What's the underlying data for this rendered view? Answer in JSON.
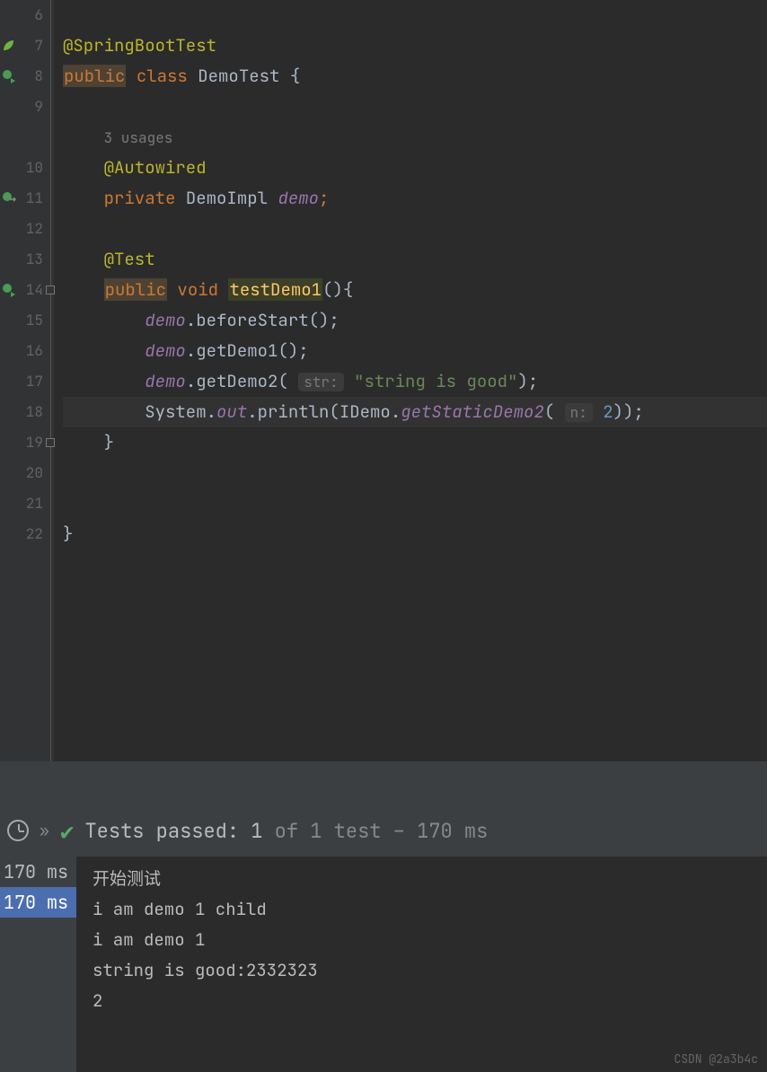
{
  "gutter": {
    "lines": [
      "6",
      "7",
      "8",
      "9",
      "",
      "10",
      "11",
      "12",
      "13",
      "14",
      "15",
      "16",
      "17",
      "18",
      "19",
      "20",
      "21",
      "22"
    ]
  },
  "code": {
    "annotation1": "@SpringBootTest",
    "kwPublic": "public",
    "kwClass": "class",
    "clsName": "DemoTest",
    "braceOpen": "{",
    "usages": "3 usages",
    "autowired": "@Autowired",
    "kwPrivate": "private",
    "type": "DemoImpl",
    "field": "demo",
    "testAnn": "@Test",
    "kwVoid": "void",
    "methodName": "testDemo1",
    "methodSig": "(){",
    "line15a": "demo",
    "line15b": ".beforeStart();",
    "line16a": "demo",
    "line16b": ".getDemo1();",
    "line17a": "demo",
    "line17b": ".getDemo2(",
    "hint17": "str:",
    "str17": "\"string is good\"",
    "line17c": ");",
    "line18a": "System.",
    "line18out": "out",
    "line18b": ".println(IDemo.",
    "line18static": "getStaticDemo2",
    "line18c": "(",
    "hint18": "n:",
    "num18": "2",
    "line18d": "));",
    "braceClose1": "}",
    "braceClose2": "}"
  },
  "tests": {
    "header_passed": "Tests passed: 1",
    "header_rest": " of 1 test – 170 ms",
    "times": [
      "170 ms",
      "170 ms"
    ],
    "output": [
      "开始测试",
      "i am demo 1 child",
      "i am demo 1",
      "string is good:2332323",
      "2"
    ]
  },
  "watermark": "CSDN @2a3b4c"
}
